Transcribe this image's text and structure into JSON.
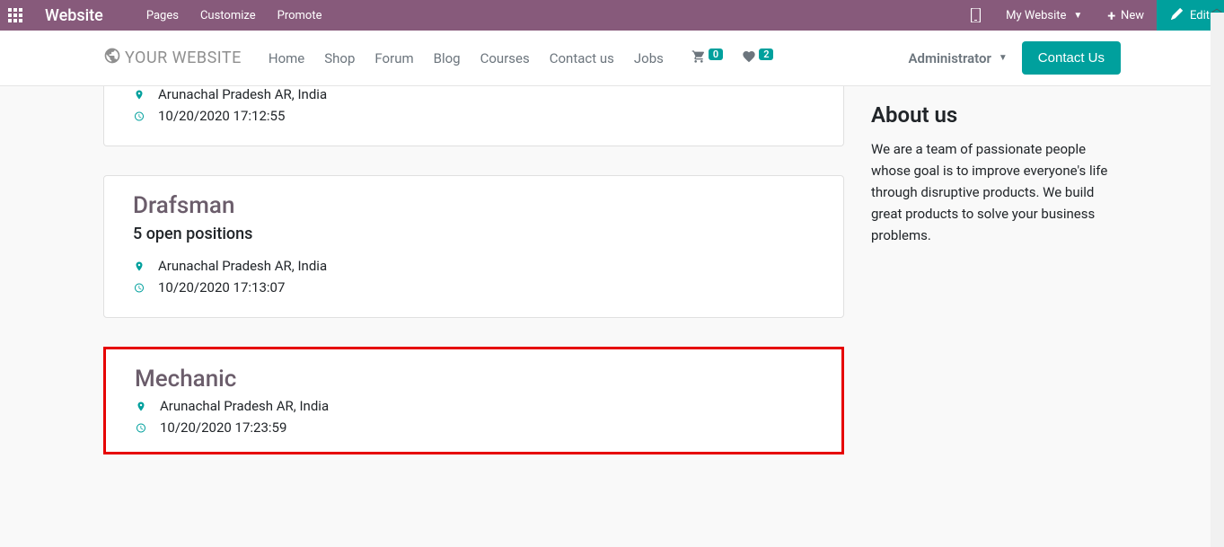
{
  "topbar": {
    "brand": "Website",
    "menu": [
      "Pages",
      "Customize",
      "Promote"
    ],
    "my_website": "My Website",
    "new_label": "New",
    "edit_label": "Edit"
  },
  "sitenav": {
    "logo_text": "YOUR WEBSITE",
    "links": [
      "Home",
      "Shop",
      "Forum",
      "Blog",
      "Courses",
      "Contact us",
      "Jobs"
    ],
    "cart_count": "0",
    "wish_count": "2",
    "admin_label": "Administrator",
    "contact_label": "Contact Us"
  },
  "jobs": [
    {
      "title": "",
      "positions": "",
      "location": "Arunachal Pradesh AR, India",
      "datetime": "10/20/2020 17:12:55",
      "partial": true,
      "highlighted": false
    },
    {
      "title": "Drafsman",
      "positions": "5 open positions",
      "location": "Arunachal Pradesh AR, India",
      "datetime": "10/20/2020 17:13:07",
      "partial": false,
      "highlighted": false
    },
    {
      "title": "Mechanic",
      "positions": "",
      "location": "Arunachal Pradesh AR, India",
      "datetime": "10/20/2020 17:23:59",
      "partial": false,
      "highlighted": true
    }
  ],
  "about": {
    "title": "About us",
    "text": "We are a team of passionate people whose goal is to improve everyone's life through disruptive products. We build great products to solve your business problems."
  }
}
